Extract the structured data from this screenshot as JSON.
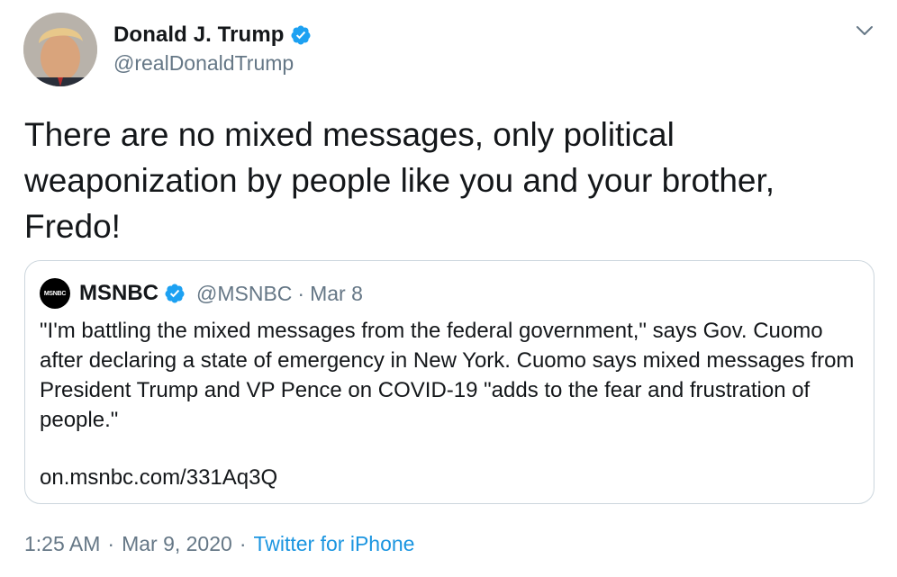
{
  "author": {
    "name": "Donald J. Trump",
    "handle": "@realDonaldTrump",
    "verified_icon": "verified-badge-icon"
  },
  "tweet": {
    "text": "There are no mixed messages, only political weaponization by people like you and your brother, Fredo!"
  },
  "quoted": {
    "logo_text": "MSNBC",
    "name": "MSNBC",
    "handle": "@MSNBC",
    "separator": "·",
    "date": "Mar 8",
    "text": "\"I'm battling the mixed messages from the federal government,\" says Gov. Cuomo after declaring a state of emergency in New York. Cuomo says mixed messages from President Trump and VP Pence on COVID-19 \"adds to the fear and frustration of people.\"",
    "link": "on.msnbc.com/331Aq3Q"
  },
  "footer": {
    "time": "1:25 AM",
    "separator": "·",
    "date": "Mar 9, 2020",
    "source": "Twitter for iPhone"
  },
  "colors": {
    "accent": "#1da1f2",
    "secondary_text": "#657786",
    "link": "#1b95e0",
    "border": "#ccd6dd"
  }
}
